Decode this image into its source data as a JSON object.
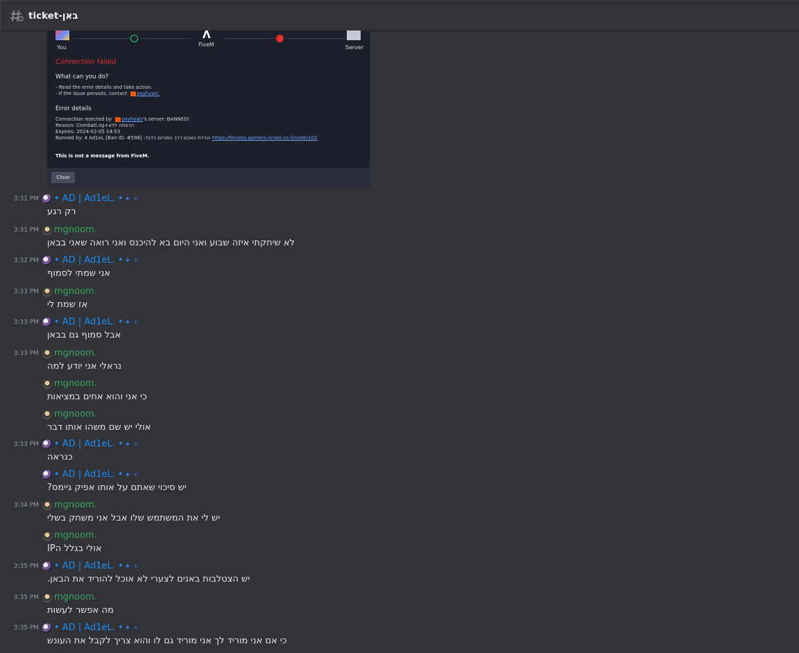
{
  "channel": {
    "title": "ticket-באן",
    "icon": "threads-hash-icon"
  },
  "attachment": {
    "you_label": "You",
    "fivem_label": "FiveM",
    "server_label": "Server",
    "connection_failed": "Connection failed",
    "what_can_you_do": "What can you do?",
    "tip1": "- Read the error details and take action.",
    "tip2_prefix": "- If the issue persists, contact",
    "tip2_user": "psyhyatr.",
    "error_details": "Error details",
    "rejected_prefix": "Connection rejected by",
    "rejected_user": "psyhyatr",
    "rejected_suffix": "'s server: BANNED!",
    "reason": "Reason: Combatl.og+הרפתה ללא",
    "expires": "Expires: 2024-02-05 14:53",
    "banned_by": "Banned by: 4 Ad1eL [Ban ID: #598] :הורדת באנים דרך הפורום בלבד",
    "forum_link": "https://forums.gamers-israel.co.il/node/102",
    "not_fivem": "This is not a message from FiveM.",
    "close_label": "Close"
  },
  "users": {
    "ad": {
      "name": "• AD | Ad1eL. •",
      "badge": "✦ ✧"
    },
    "mg": {
      "name": "mgnoom."
    }
  },
  "messages": [
    {
      "user": "ad",
      "time": "3:31 PM",
      "text": "רק רגע"
    },
    {
      "user": "mg",
      "time": "3:31 PM",
      "text": "לא שיחקתי איזה שבוע ואני היום בא להיכנס ואני רואה שאני בבאן"
    },
    {
      "user": "ad",
      "time": "3:32 PM",
      "text": "אני שמתי לסמוף"
    },
    {
      "user": "mg",
      "time": "3:33 PM",
      "text": "אז שמת לי"
    },
    {
      "user": "ad",
      "time": "3:33 PM",
      "text": "אבל סמוף גם בבאן"
    },
    {
      "user": "mg",
      "time": "3:33 PM",
      "text": "נראלי אני יודע למה"
    },
    {
      "user": "mg",
      "time": "",
      "text": "כי אני והוא אחים במציאות"
    },
    {
      "user": "mg",
      "time": "",
      "text": "אולי יש שם משהו אותו דבר"
    },
    {
      "user": "ad",
      "time": "3:33 PM",
      "text": "כנראה"
    },
    {
      "user": "ad",
      "time": "",
      "text": "יש סיכוי שאתם על אותו אפיק גיימס?"
    },
    {
      "user": "mg",
      "time": "3:34 PM",
      "text": "יש לי את המשתמש שלו אבל אני משחק בשלי"
    },
    {
      "user": "mg",
      "time": "",
      "text": "אולי בגלל הIP"
    },
    {
      "user": "ad",
      "time": "3:35 PM",
      "text": "יש הצטלבות באנים לצערי לא אוכל להוריד את הבאן."
    },
    {
      "user": "mg",
      "time": "3:35 PM",
      "text": "מה אפשר לעשות"
    },
    {
      "user": "ad",
      "time": "3:35 PM",
      "text": "כי אם אני מוריד לך אני מוריד גם לו והוא צריך לקבל את העונש"
    }
  ]
}
